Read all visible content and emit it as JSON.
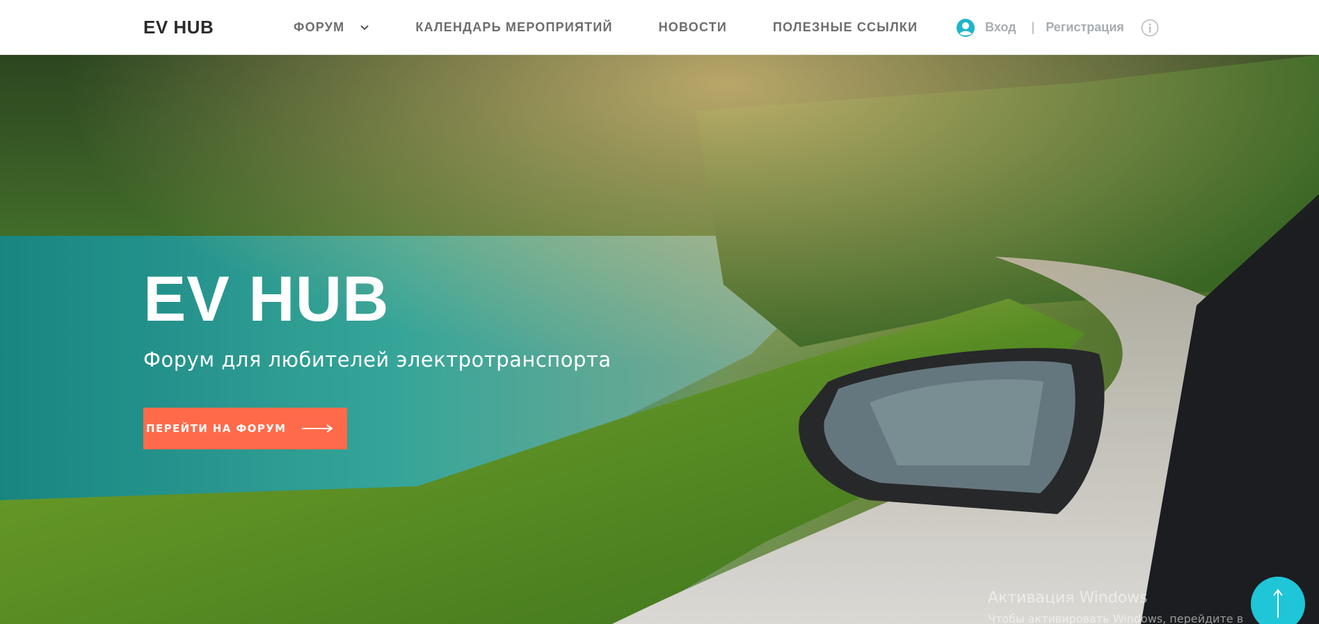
{
  "header": {
    "brand": "EV HUB",
    "nav": [
      {
        "label": "ФОРУМ",
        "has_dropdown": true
      },
      {
        "label": "КАЛЕНДАРЬ МЕРОПРИЯТИЙ"
      },
      {
        "label": "НОВОСТИ"
      },
      {
        "label": "ПОЛЕЗНЫЕ ССЫЛКИ"
      }
    ],
    "auth": {
      "login_label": "Вход",
      "separator": "|",
      "register_label": "Регистрация"
    },
    "icons": {
      "user": "user-circle-icon",
      "dropdown": "chevron-down-icon",
      "info": "info-circle-icon"
    }
  },
  "hero": {
    "title": "EV HUB",
    "subtitle": "Форум для любителей электротранспорта",
    "cta_label": "ПЕРЕЙТИ НА ФОРУМ",
    "cta_icon": "arrow-right-icon",
    "background": "lake-road-car-mirror-photo"
  },
  "scroll_top": {
    "icon": "arrow-up-icon"
  },
  "windows_watermark": {
    "title": "Активация Windows",
    "text": "Чтобы активировать Windows, перейдите в раздел \"Параметры\"."
  },
  "colors": {
    "accent": "#ff6b4a",
    "scroll_button": "#1fc6d8",
    "user_icon": "#1fb5c9",
    "nav_text": "#6d6d6d",
    "muted_text": "#a8adb2"
  }
}
